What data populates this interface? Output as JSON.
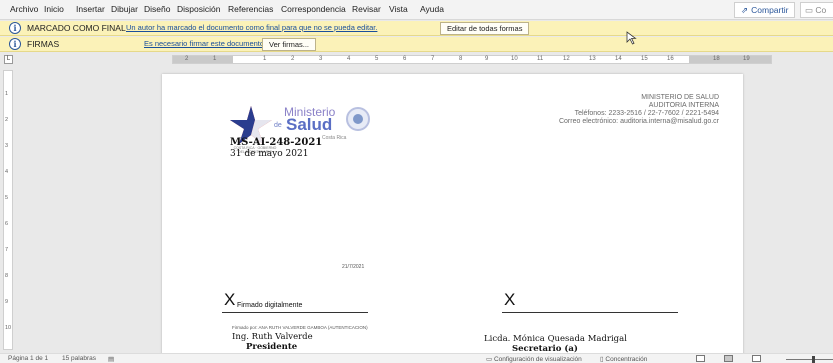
{
  "menu": {
    "items": [
      "Archivo",
      "Inicio",
      "Insertar",
      "Dibujar",
      "Diseño",
      "Disposición",
      "Referencias",
      "Correspondencia",
      "Revisar",
      "Vista",
      "Ayuda"
    ],
    "share_label": "Compartir",
    "comments_label": "Co"
  },
  "final_bar": {
    "title": "MARCADO COMO FINAL",
    "message": "Un autor ha marcado el documento como final para que no se pueda editar.",
    "button": "Editar de todas formas"
  },
  "signatures_bar": {
    "title": "FIRMAS",
    "message": "Es necesario firmar este documento.",
    "button": "Ver firmas..."
  },
  "ruler": {
    "numbers": [
      "2",
      "1",
      "1",
      "2",
      "3",
      "4",
      "5",
      "6",
      "7",
      "8",
      "9",
      "10",
      "11",
      "12",
      "13",
      "14",
      "15",
      "16",
      "18",
      "19"
    ],
    "vertical_numbers": [
      "1",
      "2",
      "3",
      "4",
      "5",
      "6",
      "7",
      "8",
      "9",
      "10"
    ]
  },
  "document": {
    "logo": {
      "word1": "Ministerio",
      "de": "de",
      "word2": "Salud",
      "country": "Costa Rica",
      "sub": "COSTA RICA · GOBIERNO DEL BICENTENARIO"
    },
    "header_lines": [
      "MINISTERIO DE SALUD",
      "AUDITORIA INTERNA",
      "Teléfonos: 2233-2516 / 22-7-7602 / 2221-5494",
      "Correo electrónico: auditoria.interna@misalud.go.cr"
    ],
    "ref_code": "MS-AI-248-2021",
    "ref_date": "31 de mayo 2021",
    "stamp_date": "21/7/2021",
    "signature1": {
      "x": "X",
      "label": "Firmado digitalmente",
      "signed_by": "Firmado por: ANA RUTH VALVERDE GAMBOA (AUTENTICACION)",
      "name": "Ing. Ruth Valverde",
      "role": "Presidente"
    },
    "signature2": {
      "x": "X",
      "name": "Licda. Mónica Quesada Madrigal",
      "role": "Secretario (a)"
    }
  },
  "status": {
    "page": "Página 1 de 1",
    "words": "15 palabras",
    "view_settings": "Configuración de visualización",
    "focus": "Concentración"
  },
  "colors": {
    "accent": "#2b579a",
    "message_bar": "#fbf2b8",
    "logo_blue": "#5a6ec4"
  }
}
